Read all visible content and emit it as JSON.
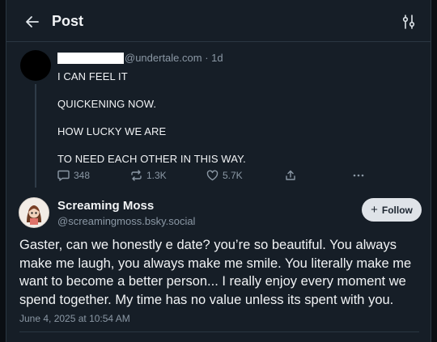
{
  "header": {
    "title": "Post"
  },
  "parent_post": {
    "handle_meta": "@undertale.com · 1d",
    "lines": [
      "I CAN FEEL IT",
      "QUICKENING NOW.",
      "HOW LUCKY WE ARE",
      "TO NEED EACH OTHER IN THIS WAY."
    ],
    "replies": "348",
    "reposts": "1.3K",
    "likes": "5.7K"
  },
  "main_post": {
    "author_name": "Screaming Moss",
    "author_handle": "@screamingmoss.bsky.social",
    "follow_label": "Follow",
    "body": "Gaster, can we honestly e date? you’re so beautiful. You always make me laugh, you always make me smile. You literally make me want to become a better person... I really enjoy every moment we spend together. My time has no value unless its spent with you.",
    "date": "June 4, 2025 at 10:54 AM"
  },
  "icons": {
    "back": "arrow-left-icon",
    "filter": "filter-sliders-icon",
    "reply": "chat-bubble-icon",
    "repost": "repost-icon",
    "like": "heart-icon",
    "share": "share-icon",
    "more": "ellipsis-icon"
  },
  "colors": {
    "background": "#161e27",
    "text": "#f1f3f5",
    "muted": "#8b98a5",
    "border": "#2a3642",
    "follow_bg": "#dfe3e8"
  }
}
